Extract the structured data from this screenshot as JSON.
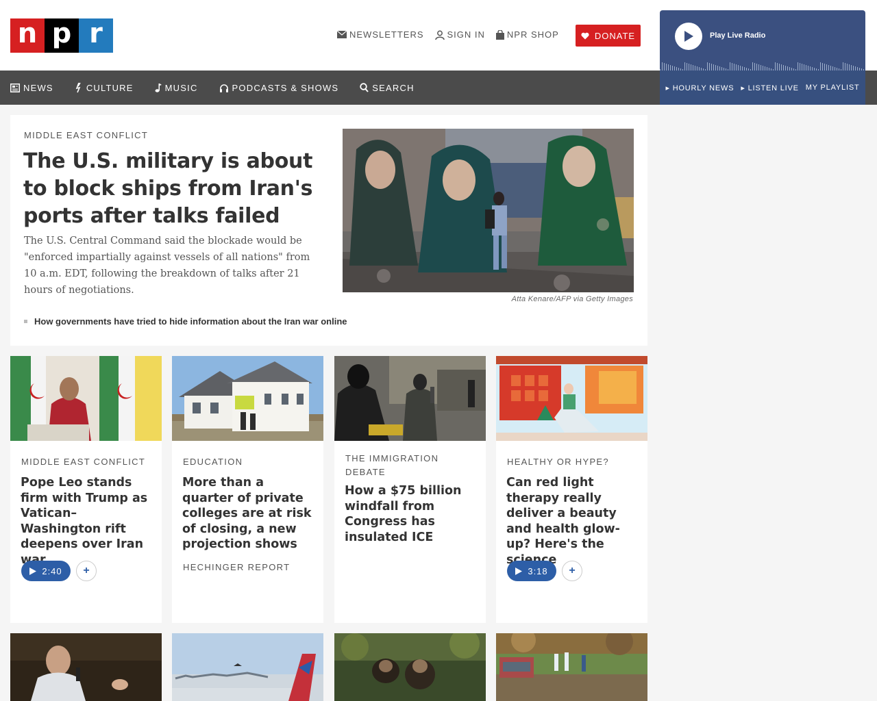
{
  "header": {
    "logo_letters": [
      "n",
      "p",
      "r"
    ],
    "utility_nav": [
      "NEWSLETTERS",
      "SIGN IN",
      "NPR SHOP"
    ],
    "donate_label": "DONATE"
  },
  "player": {
    "label": "Play Live Radio",
    "links": [
      "HOURLY NEWS",
      "LISTEN LIVE",
      "MY PLAYLIST"
    ]
  },
  "main_nav": [
    "NEWS",
    "CULTURE",
    "MUSIC",
    "PODCASTS & SHOWS",
    "SEARCH"
  ],
  "hero": {
    "slug": "MIDDLE EAST CONFLICT",
    "headline": "The U.S. military is about to block ships from Iran's ports after talks failed",
    "teaser": "The U.S. Central Command said the blockade would be \"enforced impartially against vessels of all nations\" from 10 a.m. EDT, following the breakdown of talks after 21 hours of negotiations.",
    "related": "How governments have tried to hide information about the Iran war online",
    "credit": "Atta Kenare/AFP via Getty Images"
  },
  "cards": [
    {
      "slug": "MIDDLE EAST CONFLICT",
      "title": "Pope Leo stands firm with Trump as Vatican–Washington rift deepens over Iran war",
      "audio": "2:40"
    },
    {
      "slug": "EDUCATION",
      "title": "More than a quarter of private colleges are at risk of closing, a new projection shows",
      "source": "HECHINGER REPORT"
    },
    {
      "slug": "THE IMMIGRATION DEBATE",
      "title": "How a $75 billion windfall from Congress has insulated ICE"
    },
    {
      "slug": "HEALTHY OR HYPE?",
      "title": "Can red light therapy really deliver a beauty and health glow-up? Here's the science",
      "audio": "3:18"
    }
  ],
  "colors": {
    "brand_red": "#d62021",
    "brand_blue": "#237bbd",
    "nav_bg": "#4b4b4b",
    "player_bg": "#3b5080",
    "audio_btn": "#2d5ea7"
  }
}
